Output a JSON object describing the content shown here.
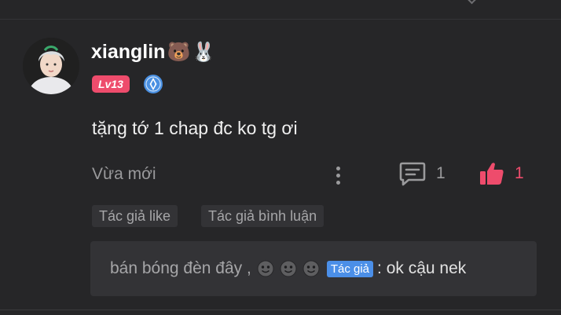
{
  "comment": {
    "username": "xianglin",
    "name_emojis": [
      "🐻",
      "🐰"
    ],
    "level": "Lv13",
    "text": "tặng tớ 1 chap đc ko tg ơi",
    "timestamp": "Vừa mới",
    "reply_count": "1",
    "like_count": "1",
    "tags": [
      "Tác giả like",
      "Tác giả bình luận"
    ]
  },
  "reply": {
    "name": "bán bóng đèn đây ,",
    "author_tag": "Tác giả",
    "separator": ":",
    "message": "ok cậu nek"
  },
  "colors": {
    "background": "#262628",
    "accent": "#ee4c6c",
    "author_tag": "#4b8fe8",
    "tier_badge": "#4a90e2"
  }
}
